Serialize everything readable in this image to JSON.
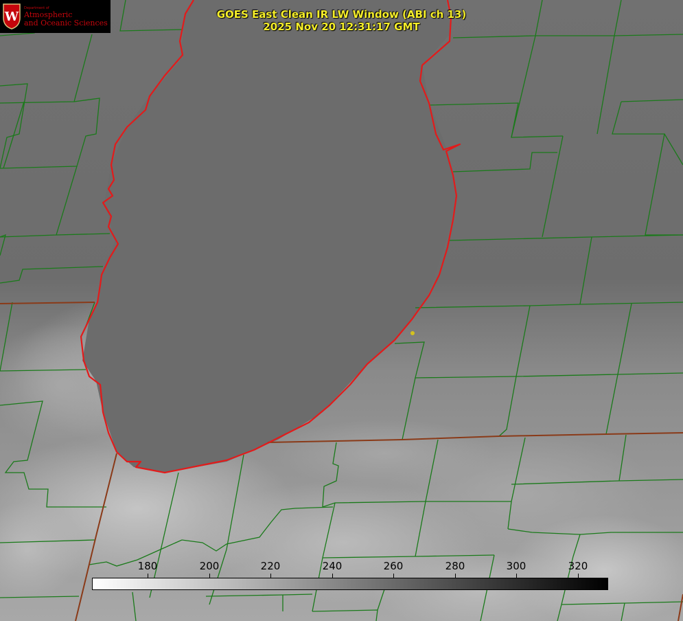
{
  "title": {
    "line1": "GOES East Clean IR LW Window (ABI ch 13)",
    "line2": "2025 Nov 20 12:31:17 GMT"
  },
  "logo": {
    "department": "Department of",
    "line1": "Atmospheric",
    "line2": "and Oceanic Sciences",
    "seal_letter": "W",
    "color": "#c5050c"
  },
  "colorbar": {
    "ticks": [
      "180",
      "200",
      "220",
      "240",
      "260",
      "280",
      "300",
      "320"
    ],
    "colormap": "white-to-black"
  },
  "colors": {
    "county_lines": "#1a7a1a",
    "shoreline": "#e21b1b",
    "state_line": "#8a3a18",
    "marker": "#d4c21e",
    "title": "#f5ee2a"
  }
}
